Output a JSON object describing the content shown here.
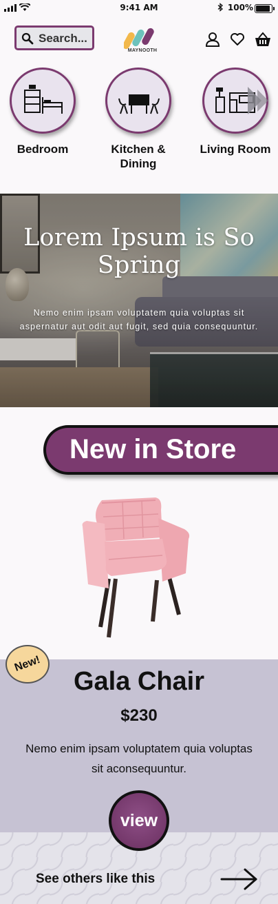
{
  "status_bar": {
    "time": "9:41 AM",
    "battery": "100%",
    "battery_level": 1.0
  },
  "header": {
    "search_placeholder": "Search...",
    "logo_text": "MAYNOOTH",
    "brand_colors": [
      "#f2b84b",
      "#6cc2bc",
      "#7b3a6f"
    ]
  },
  "categories": [
    {
      "label": "Bedroom",
      "icon": "bedroom-icon"
    },
    {
      "label": "Kitchen & Dining",
      "icon": "dining-icon"
    },
    {
      "label": "Living Room",
      "icon": "living-room-icon"
    }
  ],
  "hero": {
    "title": "Lorem Ipsum is So Spring",
    "body": "Nemo enim ipsam voluptatem quia voluptas sit aspernatur aut odit aut fugit, sed quia consequuntur."
  },
  "section": {
    "title": "New in Store"
  },
  "product": {
    "badge": "New!",
    "name": "Gala Chair",
    "price": "$230",
    "description": "Nemo enim ipsam voluptatem quia voluptas sit aconsequuntur.",
    "view_label": "view"
  },
  "footer": {
    "cta": "See others like this"
  },
  "colors": {
    "accent": "#7b3a6f",
    "panel": "#c6c2d3",
    "badge": "#f6d79c"
  }
}
